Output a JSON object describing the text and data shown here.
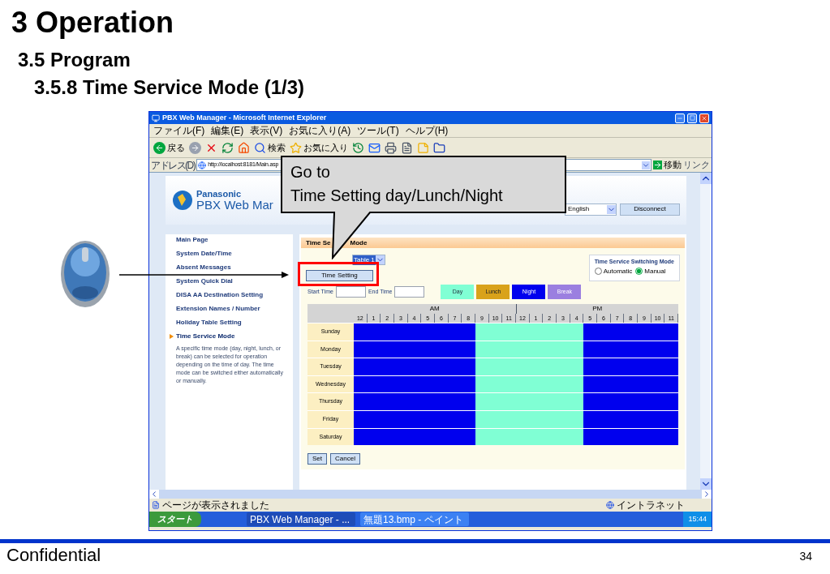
{
  "slide": {
    "title": "3 Operation",
    "subtitle": "3.5 Program",
    "section": "3.5.8 Time Service Mode (1/3)",
    "footer": "Confidential",
    "page": "34"
  },
  "window": {
    "title": "PBX Web Manager - Microsoft Internet Explorer"
  },
  "menu": [
    "ファイル(F)",
    "編集(E)",
    "表示(V)",
    "お気に入り(A)",
    "ツール(T)",
    "ヘルプ(H)"
  ],
  "toolbar": [
    {
      "kind": "back",
      "label": "戻る"
    },
    {
      "kind": "forward"
    },
    {
      "kind": "stop"
    },
    {
      "kind": "refresh"
    },
    {
      "kind": "home"
    },
    {
      "kind": "search",
      "label": "検索"
    },
    {
      "kind": "favorites",
      "label": "お気に入り"
    },
    {
      "kind": "history"
    },
    {
      "kind": "mail"
    },
    {
      "kind": "print"
    },
    {
      "kind": "edit"
    },
    {
      "kind": "note"
    },
    {
      "kind": "folder"
    }
  ],
  "address": {
    "label": "アドレス(D)",
    "url": "http://localhost:8181/Main.asp",
    "go": "移動",
    "links": "リンク"
  },
  "page": {
    "brand": "Panasonic",
    "product": "PBX Web Mar",
    "language": "English",
    "disconnect": "Disconnect"
  },
  "sidebar": {
    "items": [
      {
        "label": "Main Page",
        "selected": false
      },
      {
        "label": "System Date/Time",
        "selected": false
      },
      {
        "label": "Absent Messages",
        "selected": false
      },
      {
        "label": "System Quick Dial",
        "selected": false
      },
      {
        "label": "DISA AA Destination Setting",
        "selected": false
      },
      {
        "label": "Extension Names / Number",
        "selected": false
      },
      {
        "label": "Holiday Table Setting",
        "selected": false
      },
      {
        "label": "Time Service Mode",
        "selected": true,
        "description": "A specific time mode (day, night, lunch, or break) can be selected for operation depending on the time of day. The time mode can be switched either automatically or manually."
      }
    ]
  },
  "panel": {
    "title_parts": [
      "Time Se",
      "Mode"
    ],
    "table_select": "Table 1",
    "time_setting": "Time Setting",
    "start_label": "Start Time",
    "end_label": "End Time",
    "switch_title": "Time Service Switching Mode",
    "switch_options": [
      {
        "label": "Automatic",
        "selected": false
      },
      {
        "label": "Manual",
        "selected": true
      }
    ],
    "modes": [
      {
        "label": "Day",
        "kind": "day",
        "color": "#80ffd4"
      },
      {
        "label": "Lunch",
        "kind": "lunch",
        "color": "#d9a21b"
      },
      {
        "label": "Night",
        "kind": "night",
        "color": "#0000ee"
      },
      {
        "label": "Break",
        "kind": "break",
        "color": "#9b7fe0"
      }
    ],
    "am": "AM",
    "pm": "PM",
    "hours": [
      "12",
      "1",
      "2",
      "3",
      "4",
      "5",
      "6",
      "7",
      "8",
      "9",
      "10",
      "11",
      "12",
      "1",
      "2",
      "3",
      "4",
      "5",
      "6",
      "7",
      "8",
      "9",
      "10",
      "11"
    ],
    "rows": [
      {
        "day": "Sunday",
        "slots": [
          {
            "kind": "night"
          },
          {
            "kind": "night"
          },
          {
            "kind": "night"
          },
          {
            "kind": "night"
          },
          {
            "kind": "night"
          },
          {
            "kind": "night"
          },
          {
            "kind": "night"
          },
          {
            "kind": "night"
          },
          {
            "kind": "night"
          },
          {
            "kind": "day"
          },
          {
            "kind": "day"
          },
          {
            "kind": "day"
          },
          {
            "kind": "day"
          },
          {
            "kind": "day"
          },
          {
            "kind": "day"
          },
          {
            "kind": "day"
          },
          {
            "kind": "day"
          },
          {
            "kind": "night"
          },
          {
            "kind": "night"
          },
          {
            "kind": "night"
          },
          {
            "kind": "night"
          },
          {
            "kind": "night"
          },
          {
            "kind": "night"
          },
          {
            "kind": "night"
          }
        ]
      },
      {
        "day": "Monday",
        "slots": [
          {
            "kind": "night"
          },
          {
            "kind": "night"
          },
          {
            "kind": "night"
          },
          {
            "kind": "night"
          },
          {
            "kind": "night"
          },
          {
            "kind": "night"
          },
          {
            "kind": "night"
          },
          {
            "kind": "night"
          },
          {
            "kind": "night"
          },
          {
            "kind": "day"
          },
          {
            "kind": "day"
          },
          {
            "kind": "day"
          },
          {
            "kind": "day"
          },
          {
            "kind": "day"
          },
          {
            "kind": "day"
          },
          {
            "kind": "day"
          },
          {
            "kind": "day"
          },
          {
            "kind": "night"
          },
          {
            "kind": "night"
          },
          {
            "kind": "night"
          },
          {
            "kind": "night"
          },
          {
            "kind": "night"
          },
          {
            "kind": "night"
          },
          {
            "kind": "night"
          }
        ]
      },
      {
        "day": "Tuesday",
        "slots": [
          {
            "kind": "night"
          },
          {
            "kind": "night"
          },
          {
            "kind": "night"
          },
          {
            "kind": "night"
          },
          {
            "kind": "night"
          },
          {
            "kind": "night"
          },
          {
            "kind": "night"
          },
          {
            "kind": "night"
          },
          {
            "kind": "night"
          },
          {
            "kind": "day"
          },
          {
            "kind": "day"
          },
          {
            "kind": "day"
          },
          {
            "kind": "day"
          },
          {
            "kind": "day"
          },
          {
            "kind": "day"
          },
          {
            "kind": "day"
          },
          {
            "kind": "day"
          },
          {
            "kind": "night"
          },
          {
            "kind": "night"
          },
          {
            "kind": "night"
          },
          {
            "kind": "night"
          },
          {
            "kind": "night"
          },
          {
            "kind": "night"
          },
          {
            "kind": "night"
          }
        ]
      },
      {
        "day": "Wednesday",
        "slots": [
          {
            "kind": "night"
          },
          {
            "kind": "night"
          },
          {
            "kind": "night"
          },
          {
            "kind": "night"
          },
          {
            "kind": "night"
          },
          {
            "kind": "night"
          },
          {
            "kind": "night"
          },
          {
            "kind": "night"
          },
          {
            "kind": "night"
          },
          {
            "kind": "day"
          },
          {
            "kind": "day"
          },
          {
            "kind": "day"
          },
          {
            "kind": "day"
          },
          {
            "kind": "day"
          },
          {
            "kind": "day"
          },
          {
            "kind": "day"
          },
          {
            "kind": "day"
          },
          {
            "kind": "night"
          },
          {
            "kind": "night"
          },
          {
            "kind": "night"
          },
          {
            "kind": "night"
          },
          {
            "kind": "night"
          },
          {
            "kind": "night"
          },
          {
            "kind": "night"
          }
        ]
      },
      {
        "day": "Thursday",
        "slots": [
          {
            "kind": "night"
          },
          {
            "kind": "night"
          },
          {
            "kind": "night"
          },
          {
            "kind": "night"
          },
          {
            "kind": "night"
          },
          {
            "kind": "night"
          },
          {
            "kind": "night"
          },
          {
            "kind": "night"
          },
          {
            "kind": "night"
          },
          {
            "kind": "day"
          },
          {
            "kind": "day"
          },
          {
            "kind": "day"
          },
          {
            "kind": "day"
          },
          {
            "kind": "day"
          },
          {
            "kind": "day"
          },
          {
            "kind": "day"
          },
          {
            "kind": "day"
          },
          {
            "kind": "night"
          },
          {
            "kind": "night"
          },
          {
            "kind": "night"
          },
          {
            "kind": "night"
          },
          {
            "kind": "night"
          },
          {
            "kind": "night"
          },
          {
            "kind": "night"
          }
        ]
      },
      {
        "day": "Friday",
        "slots": [
          {
            "kind": "night"
          },
          {
            "kind": "night"
          },
          {
            "kind": "night"
          },
          {
            "kind": "night"
          },
          {
            "kind": "night"
          },
          {
            "kind": "night"
          },
          {
            "kind": "night"
          },
          {
            "kind": "night"
          },
          {
            "kind": "night"
          },
          {
            "kind": "day"
          },
          {
            "kind": "day"
          },
          {
            "kind": "day"
          },
          {
            "kind": "day"
          },
          {
            "kind": "day"
          },
          {
            "kind": "day"
          },
          {
            "kind": "day"
          },
          {
            "kind": "day"
          },
          {
            "kind": "night"
          },
          {
            "kind": "night"
          },
          {
            "kind": "night"
          },
          {
            "kind": "night"
          },
          {
            "kind": "night"
          },
          {
            "kind": "night"
          },
          {
            "kind": "night"
          }
        ]
      },
      {
        "day": "Saturday",
        "slots": [
          {
            "kind": "night"
          },
          {
            "kind": "night"
          },
          {
            "kind": "night"
          },
          {
            "kind": "night"
          },
          {
            "kind": "night"
          },
          {
            "kind": "night"
          },
          {
            "kind": "night"
          },
          {
            "kind": "night"
          },
          {
            "kind": "night"
          },
          {
            "kind": "day"
          },
          {
            "kind": "day"
          },
          {
            "kind": "day"
          },
          {
            "kind": "day"
          },
          {
            "kind": "day"
          },
          {
            "kind": "day"
          },
          {
            "kind": "day"
          },
          {
            "kind": "day"
          },
          {
            "kind": "night"
          },
          {
            "kind": "night"
          },
          {
            "kind": "night"
          },
          {
            "kind": "night"
          },
          {
            "kind": "night"
          },
          {
            "kind": "night"
          },
          {
            "kind": "night"
          }
        ]
      }
    ],
    "buttons": [
      "Set",
      "Cancel"
    ]
  },
  "status": {
    "text": "ページが表示されました",
    "zone": "イントラネット"
  },
  "taskbar": {
    "start": "スタート",
    "tasks": [
      "PBX Web Manager - ...",
      "無題13.bmp - ペイント"
    ],
    "clock": "15:44"
  },
  "callout": {
    "lines": [
      "Go to",
      "Time Setting day/Lunch/Night"
    ]
  }
}
